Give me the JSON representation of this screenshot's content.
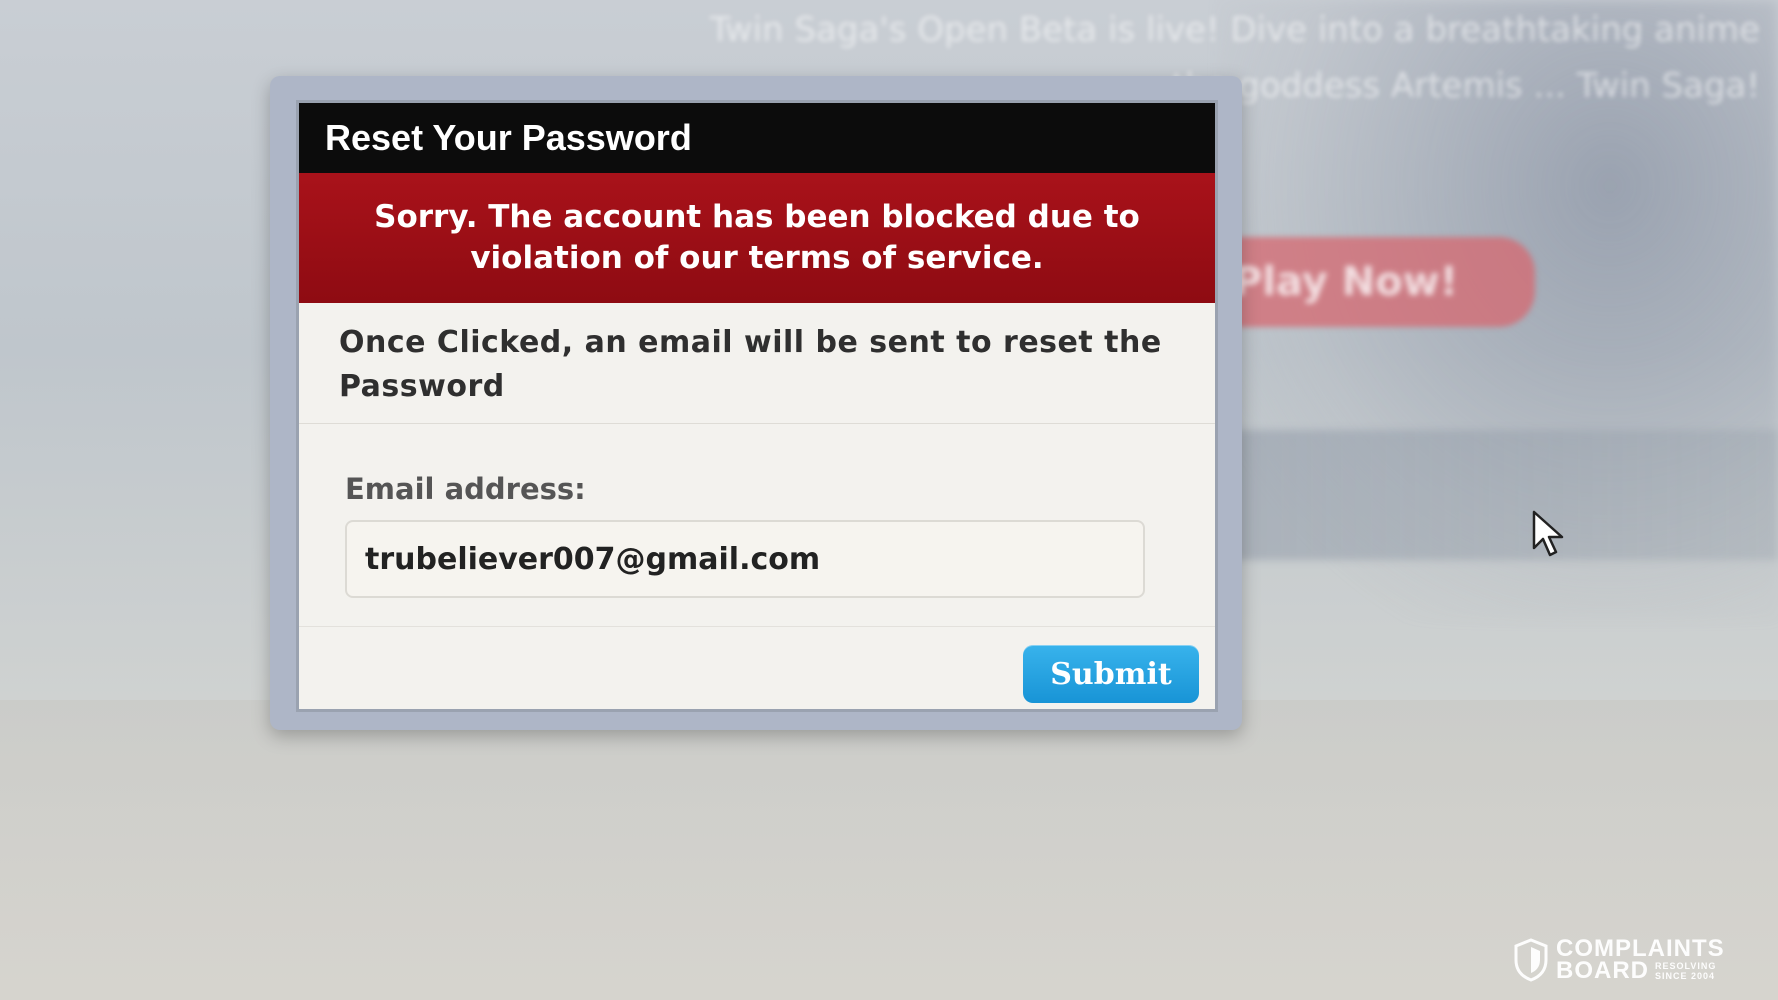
{
  "background": {
    "banner_text": "Twin Saga's Open Beta is live! Dive into a breathtaking anime ... the goddess Artemis ... Twin Saga!",
    "play_button_label": "Play Now!"
  },
  "dialog": {
    "title": "Reset Your Password",
    "error_message": "Sorry. The account has been blocked due to violation of our terms of service.",
    "info_text": "Once Clicked, an email will be sent to reset the Password",
    "email_label": "Email address:",
    "email_value": "trubeliever007@gmail.com",
    "submit_label": "Submit"
  },
  "watermark": {
    "line1": "COMPLAINTS",
    "line2": "BOARD",
    "tagline_1": "RESOLVING",
    "tagline_2": "SINCE 2004"
  },
  "colors": {
    "header_bg": "#0c0c0c",
    "error_bg": "#a9121a",
    "submit_bg": "#1894d6",
    "frame": "#aeb6c7"
  }
}
